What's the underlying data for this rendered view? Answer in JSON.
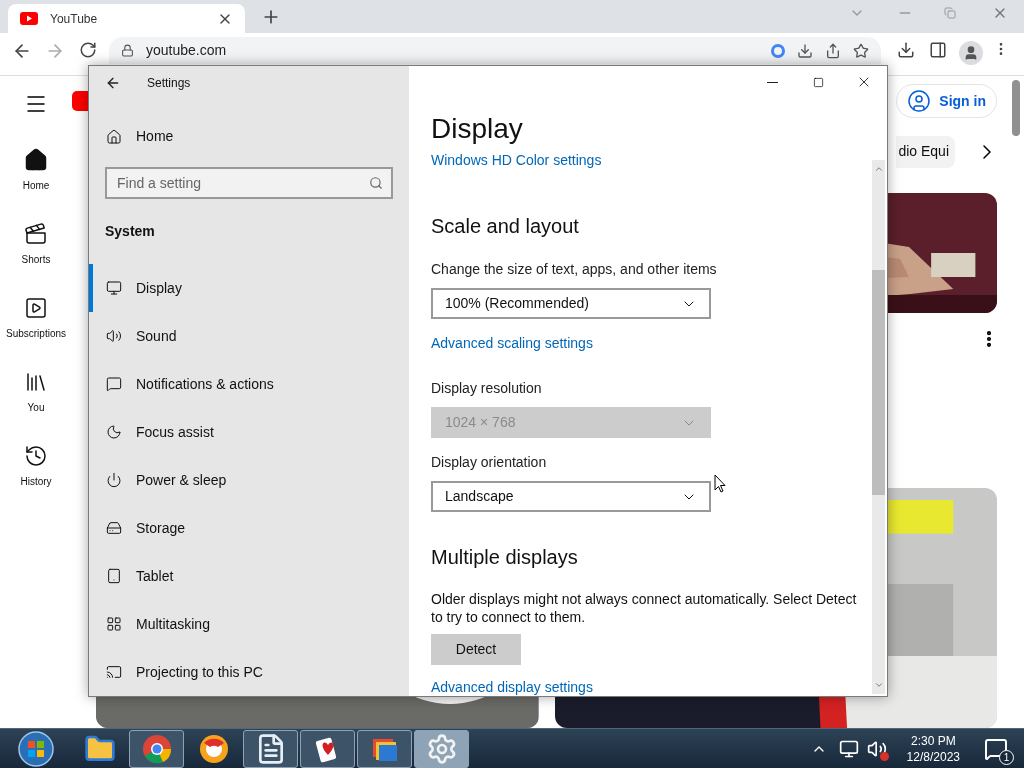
{
  "browser": {
    "tab_title": "YouTube",
    "url": "youtube.com"
  },
  "youtube": {
    "nav": [
      {
        "label": "Home",
        "selected": true
      },
      {
        "label": "Shorts",
        "selected": false
      },
      {
        "label": "Subscriptions",
        "selected": false
      },
      {
        "label": "You",
        "selected": false
      },
      {
        "label": "History",
        "selected": false
      }
    ],
    "sign_in": "Sign in",
    "chip": "dio Equi"
  },
  "settings": {
    "title": "Settings",
    "home": "Home",
    "search": {
      "placeholder": "Find a setting"
    },
    "group": "System",
    "nav": [
      {
        "label": "Display",
        "selected": true
      },
      {
        "label": "Sound",
        "selected": false
      },
      {
        "label": "Notifications & actions",
        "selected": false
      },
      {
        "label": "Focus assist",
        "selected": false
      },
      {
        "label": "Power & sleep",
        "selected": false
      },
      {
        "label": "Storage",
        "selected": false
      },
      {
        "label": "Tablet",
        "selected": false
      },
      {
        "label": "Multitasking",
        "selected": false
      },
      {
        "label": "Projecting to this PC",
        "selected": false
      }
    ],
    "page_title": "Display",
    "content": [
      {
        "kind": "link",
        "text": "Windows HD Color settings"
      },
      {
        "kind": "heading",
        "text": "Scale and layout"
      },
      {
        "kind": "label",
        "text": "Change the size of text, apps, and other items"
      },
      {
        "kind": "dropdown",
        "value": "100% (Recommended)",
        "disabled": false
      },
      {
        "kind": "link",
        "text": "Advanced scaling settings"
      },
      {
        "kind": "label",
        "text": "Display resolution"
      },
      {
        "kind": "dropdown",
        "value": "1024 × 768",
        "disabled": true
      },
      {
        "kind": "label",
        "text": "Display orientation"
      },
      {
        "kind": "dropdown",
        "value": "Landscape",
        "disabled": false
      },
      {
        "kind": "heading",
        "text": "Multiple displays"
      },
      {
        "kind": "text",
        "text": "Older displays might not always connect automatically. Select Detect to try to connect to them."
      },
      {
        "kind": "button",
        "text": "Detect"
      },
      {
        "kind": "link",
        "text": "Advanced display settings"
      }
    ]
  },
  "taskbar": {
    "apps": [
      {
        "running": false,
        "selected": false
      },
      {
        "running": true,
        "selected": false
      },
      {
        "running": false,
        "selected": false
      },
      {
        "running": true,
        "selected": false
      },
      {
        "running": true,
        "selected": false
      },
      {
        "running": true,
        "selected": false
      },
      {
        "running": true,
        "selected": true
      }
    ],
    "time": "2:30 PM",
    "date": "12/8/2023",
    "notifications": "1"
  }
}
